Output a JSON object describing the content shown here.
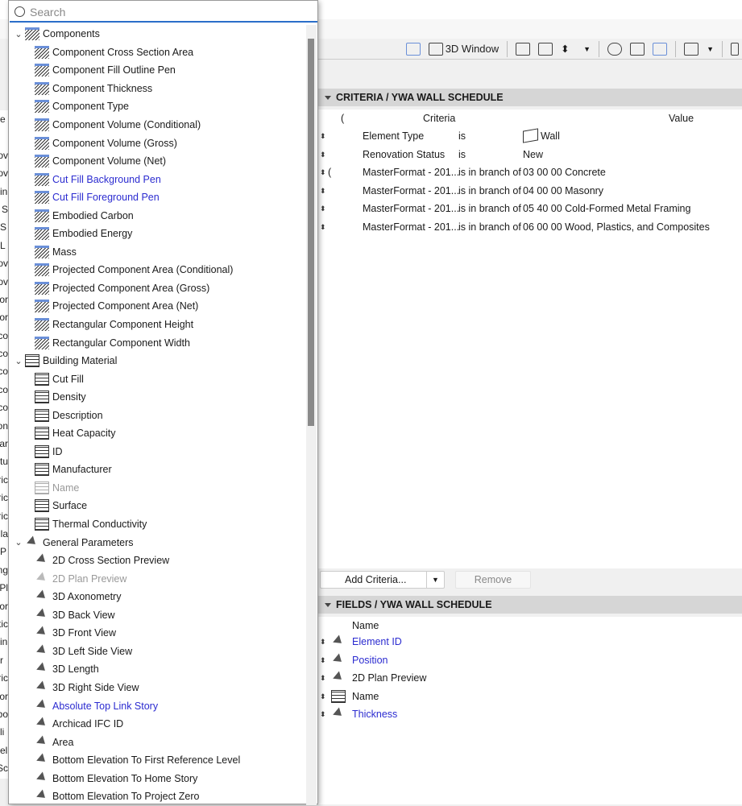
{
  "search": {
    "placeholder": "Search",
    "value": ""
  },
  "tree": [
    {
      "label": "Components",
      "kind": "comp",
      "group": true
    },
    {
      "label": "Component Cross Section Area",
      "kind": "comp"
    },
    {
      "label": "Component Fill Outline Pen",
      "kind": "comp"
    },
    {
      "label": "Component Thickness",
      "kind": "comp"
    },
    {
      "label": "Component Type",
      "kind": "comp"
    },
    {
      "label": "Component Volume (Conditional)",
      "kind": "comp"
    },
    {
      "label": "Component Volume (Gross)",
      "kind": "comp"
    },
    {
      "label": "Component Volume (Net)",
      "kind": "comp"
    },
    {
      "label": "Cut Fill Background Pen",
      "kind": "comp",
      "style": "blue"
    },
    {
      "label": "Cut Fill Foreground Pen",
      "kind": "comp",
      "style": "blue"
    },
    {
      "label": "Embodied Carbon",
      "kind": "comp"
    },
    {
      "label": "Embodied Energy",
      "kind": "comp"
    },
    {
      "label": "Mass",
      "kind": "comp"
    },
    {
      "label": "Projected Component Area (Conditional)",
      "kind": "comp"
    },
    {
      "label": "Projected Component Area (Gross)",
      "kind": "comp"
    },
    {
      "label": "Projected Component Area (Net)",
      "kind": "comp"
    },
    {
      "label": "Rectangular Component Height",
      "kind": "comp"
    },
    {
      "label": "Rectangular Component Width",
      "kind": "comp"
    },
    {
      "label": "Building Material",
      "kind": "mat",
      "group": true
    },
    {
      "label": "Cut Fill",
      "kind": "mat"
    },
    {
      "label": "Density",
      "kind": "mat"
    },
    {
      "label": "Description",
      "kind": "mat"
    },
    {
      "label": "Heat Capacity",
      "kind": "mat"
    },
    {
      "label": "ID",
      "kind": "mat"
    },
    {
      "label": "Manufacturer",
      "kind": "mat"
    },
    {
      "label": "Name",
      "kind": "mat",
      "style": "gray"
    },
    {
      "label": "Surface",
      "kind": "mat"
    },
    {
      "label": "Thermal Conductivity",
      "kind": "mat"
    },
    {
      "label": "General Parameters",
      "kind": "param",
      "group": true
    },
    {
      "label": "2D Cross Section Preview",
      "kind": "param"
    },
    {
      "label": "2D Plan Preview",
      "kind": "param",
      "style": "gray"
    },
    {
      "label": "3D Axonometry",
      "kind": "param"
    },
    {
      "label": "3D Back View",
      "kind": "param"
    },
    {
      "label": "3D Front View",
      "kind": "param"
    },
    {
      "label": "3D Left Side View",
      "kind": "param"
    },
    {
      "label": "3D Length",
      "kind": "param"
    },
    {
      "label": "3D Right Side View",
      "kind": "param"
    },
    {
      "label": "Absolute Top Link Story",
      "kind": "param",
      "style": "blue"
    },
    {
      "label": "Archicad IFC ID",
      "kind": "param"
    },
    {
      "label": "Area",
      "kind": "param"
    },
    {
      "label": "Bottom Elevation To First Reference Level",
      "kind": "param"
    },
    {
      "label": "Bottom Elevation To Home Story",
      "kind": "param"
    },
    {
      "label": "Bottom Elevation To Project Zero",
      "kind": "param"
    }
  ],
  "left_fragments": [
    "e",
    "",
    "ov",
    "ov",
    "in",
    "n S",
    "S",
    "L",
    "ov",
    "ov",
    "or",
    "or",
    "co",
    "co",
    "co",
    "co",
    "co",
    "on",
    "ar",
    "tu",
    "ric",
    "ric",
    "ric",
    "Pla",
    "P",
    "ng",
    "Pl",
    "or",
    "tic",
    "in",
    "r",
    "ric",
    "or",
    "bo",
    "li",
    "el",
    "Sc"
  ],
  "toolbar": {
    "window_label": "3D Window"
  },
  "criteria": {
    "title": "CRITERIA / YWA WALL SCHEDULE",
    "columns": {
      "paren": "(",
      "criteria": "Criteria",
      "value": "Value"
    },
    "rows": [
      {
        "paren": "",
        "name": "Element Type",
        "op": "is",
        "value": "Wall"
      },
      {
        "paren": "",
        "name": "Renovation Status",
        "op": "is",
        "value": "New"
      },
      {
        "paren": "(",
        "name": "MasterFormat - 201...",
        "op": "is in branch of",
        "value": "03 00 00 Concrete"
      },
      {
        "paren": "",
        "name": "MasterFormat - 201...",
        "op": "is in branch of",
        "value": "04 00 00 Masonry"
      },
      {
        "paren": "",
        "name": "MasterFormat - 201...",
        "op": "is in branch of",
        "value": "05 40 00 Cold-Formed Metal Framing"
      },
      {
        "paren": "",
        "name": "MasterFormat - 201...",
        "op": "is in branch of",
        "value": "06 00 00 Wood, Plastics, and Composites"
      }
    ],
    "add_label": "Add Criteria...",
    "remove_label": "Remove"
  },
  "fields": {
    "title": "FIELDS / YWA WALL SCHEDULE",
    "column": "Name",
    "rows": [
      {
        "name": "Element ID",
        "kind": "param",
        "style": "blue"
      },
      {
        "name": "Position",
        "kind": "param",
        "style": "blue"
      },
      {
        "name": "2D Plan Preview",
        "kind": "param"
      },
      {
        "name": "Name",
        "kind": "mat"
      },
      {
        "name": "Thickness",
        "kind": "param",
        "style": "blue"
      }
    ]
  }
}
